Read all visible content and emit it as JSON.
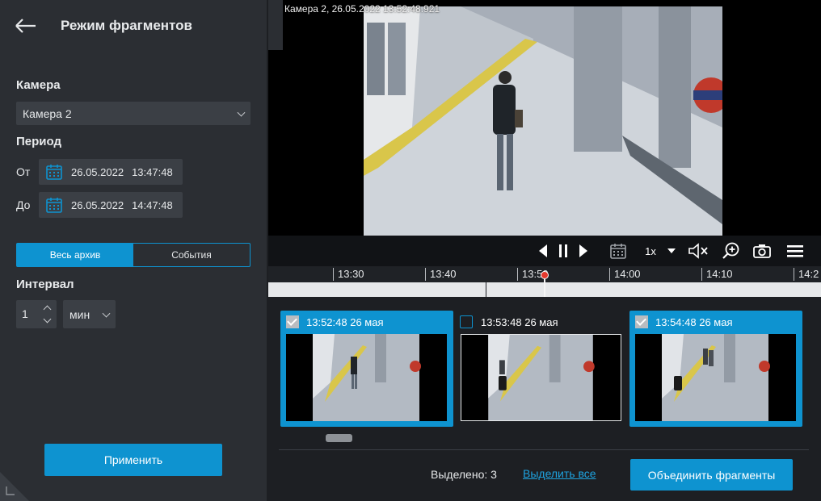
{
  "sidebar": {
    "title": "Режим фрагментов",
    "camera_label": "Камера",
    "camera_value": "Камера 2",
    "period_label": "Период",
    "from_label": "От",
    "from_date": "26.05.2022",
    "from_time": "13:47:48",
    "to_label": "До",
    "to_date": "26.05.2022",
    "to_time": "14:47:48",
    "tabs": [
      {
        "label": "Весь архив",
        "active": true
      },
      {
        "label": "События",
        "active": false
      }
    ],
    "interval_label": "Интервал",
    "interval_value": "1",
    "interval_unit": "мин",
    "apply_label": "Применить"
  },
  "video": {
    "stamp": "Камера 2, 26.05.2022 13:52:48.921",
    "speed": "1x",
    "icons": [
      "step-back-icon",
      "pause-icon",
      "step-forward-icon",
      "calendar-icon",
      "speed-dropdown-icon",
      "mute-icon",
      "zoom-in-icon",
      "snapshot-icon",
      "menu-icon"
    ]
  },
  "timeline": {
    "ticks": [
      "13:30",
      "13:40",
      "13:50",
      "14:00",
      "14:10",
      "14:2"
    ]
  },
  "fragments": {
    "items": [
      {
        "title": "13:52:48 26 мая",
        "selected": true
      },
      {
        "title": "13:53:48 26 мая",
        "selected": false
      },
      {
        "title": "13:54:48 26 мая",
        "selected": true
      }
    ],
    "selected_label": "Выделено: 3",
    "select_all_label": "Выделить все",
    "merge_label": "Объединить фрагменты"
  },
  "colors": {
    "accent": "#0e93d0",
    "panel": "#2b2e33",
    "background": "#1d1f23",
    "marker": "#e53a2e"
  }
}
